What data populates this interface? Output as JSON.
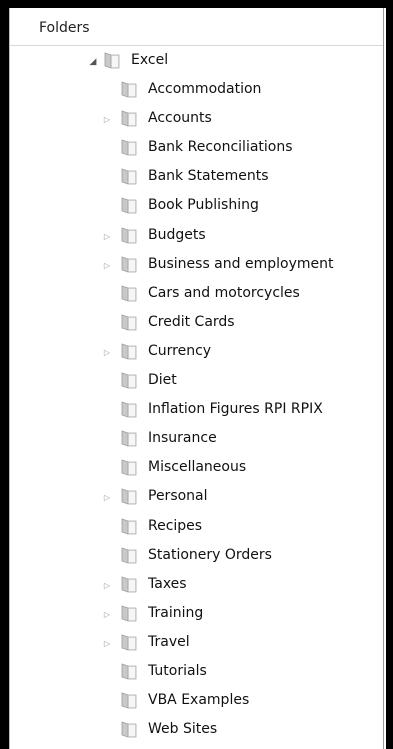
{
  "panel": {
    "title": "Folders"
  },
  "root": {
    "label": "Excel",
    "expanded": true
  },
  "items": [
    {
      "label": "Accommodation",
      "has_children": false
    },
    {
      "label": "Accounts",
      "has_children": true
    },
    {
      "label": "Bank Reconciliations",
      "has_children": false
    },
    {
      "label": "Bank Statements",
      "has_children": false
    },
    {
      "label": "Book Publishing",
      "has_children": false
    },
    {
      "label": "Budgets",
      "has_children": true
    },
    {
      "label": "Business and employment",
      "has_children": true
    },
    {
      "label": "Cars and motorcycles",
      "has_children": false
    },
    {
      "label": "Credit Cards",
      "has_children": false
    },
    {
      "label": "Currency",
      "has_children": true
    },
    {
      "label": "Diet",
      "has_children": false
    },
    {
      "label": "Inflation Figures RPI RPIX",
      "has_children": false
    },
    {
      "label": "Insurance",
      "has_children": false
    },
    {
      "label": "Miscellaneous",
      "has_children": false
    },
    {
      "label": "Personal",
      "has_children": true
    },
    {
      "label": "Recipes",
      "has_children": false
    },
    {
      "label": "Stationery Orders",
      "has_children": false
    },
    {
      "label": "Taxes",
      "has_children": true
    },
    {
      "label": "Training",
      "has_children": true
    },
    {
      "label": "Travel",
      "has_children": true
    },
    {
      "label": "Tutorials",
      "has_children": false
    },
    {
      "label": "VBA Examples",
      "has_children": false
    },
    {
      "label": "Web Sites",
      "has_children": false
    }
  ]
}
